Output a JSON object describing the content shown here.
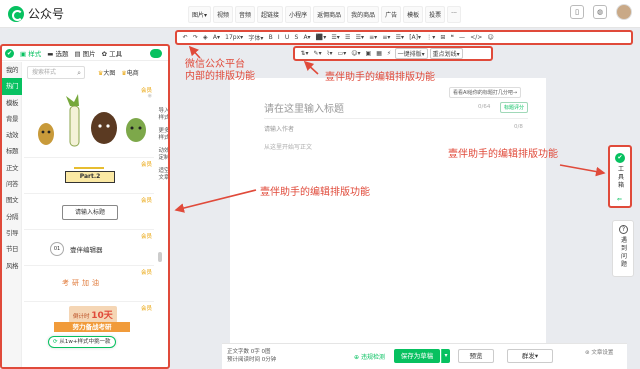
{
  "app": {
    "name": "公众号"
  },
  "topnav": [
    "图片▾",
    "视频",
    "音频",
    "超链接",
    "小程序",
    "返佣商品",
    "我的商品",
    "广告",
    "模板",
    "投票",
    "···"
  ],
  "editor_toolbar": [
    "↶",
    "↷",
    "◈",
    "A▾",
    "17px▾",
    "字体▾",
    "B",
    "I",
    "U",
    "S",
    "A▾",
    "⬛▾",
    "☰▾",
    "☰",
    "☰▾",
    "≡▾",
    "≡▾",
    "☰▾",
    "[A]▾",
    "⋮▾",
    "⊞",
    "❝",
    "—",
    "</>",
    "☺"
  ],
  "plugin_toolbar": {
    "items": [
      "⇅▾",
      "✎▾",
      "⌇▾",
      "▭▾",
      "☺▾",
      "▣",
      "▦",
      "⚡"
    ],
    "pills": [
      "一键排版▾",
      "重点划线▾"
    ]
  },
  "left_panel": {
    "tabs": [
      "✔",
      "样式",
      "选题",
      "图片",
      "工具"
    ],
    "categories": [
      "我的",
      "热门",
      "模板",
      "背景",
      "动效",
      "标题",
      "正文",
      "问答",
      "图文",
      "分隔",
      "引导",
      "节日",
      "风格"
    ],
    "active_category": "热门",
    "search_placeholder": "搜索样式",
    "filters": [
      "大图",
      "电商"
    ],
    "side_tools": [
      "导入样式",
      "更多样式",
      "动效定制",
      "适空文章"
    ],
    "cards": {
      "part2": "Part.2",
      "input_title": "请输入标题",
      "yiban_num": "01",
      "yiban": "壹伴编辑器",
      "kaoyan": "考研加油",
      "countdown": "倒计时",
      "countdown_days": "10天",
      "fighting": "努力备战考研",
      "vip": "会员"
    },
    "float_pill": "从1w+样式中挑一款"
  },
  "editor": {
    "title_placeholder": "请在这里输入标题",
    "ai_button": "看看AI给你的标题打几分吧→",
    "title_count": "0/64",
    "title_score": "标题评分",
    "author_placeholder": "请输入作者",
    "author_count": "0/8",
    "body_placeholder": "从这里开始写正文"
  },
  "bottom_bar": {
    "word_count": "正文字数 0字 0图",
    "read_time": "预计阅读时间 0分钟",
    "check": "违规检测",
    "save": "保存为草稿",
    "preview": "预览",
    "publish": "群发▾",
    "article_settings": "文章设置"
  },
  "right_tools": {
    "toolbox": "工具箱",
    "toolbox_arrow": "⇐",
    "meet_question": "遇到问题"
  },
  "annotations": {
    "wechat": "微信公众平台\n内部的排版功能",
    "plugin_top": "壹伴助手的编辑排版功能",
    "plugin_right": "壹伴助手的编辑排版功能",
    "plugin_left": "壹伴助手的编辑排版功能"
  },
  "colors": {
    "brand": "#07c160",
    "annotation": "#e04a3a"
  }
}
